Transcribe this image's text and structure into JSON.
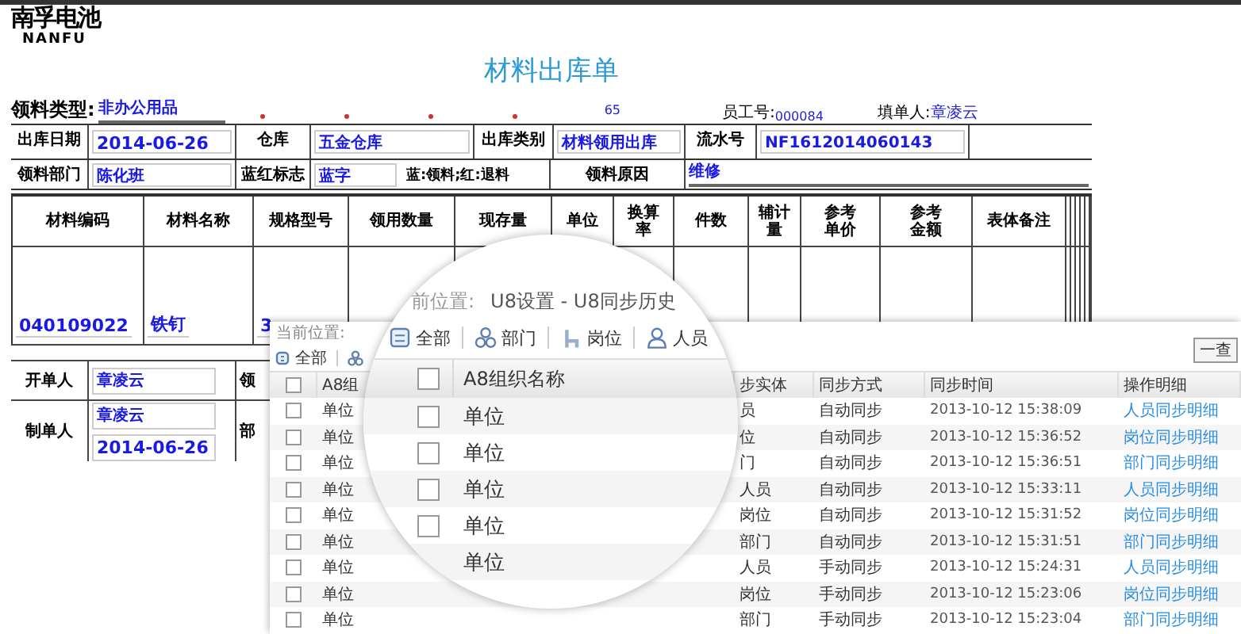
{
  "logo": {
    "name": "南孚电池",
    "brand": "NANFU"
  },
  "form": {
    "title": "材料出库单",
    "material_type": {
      "label": "领料类型:",
      "value": "非办公用品"
    },
    "code_fragment": "65",
    "employee_no": {
      "label": "员工号:",
      "value": "000084"
    },
    "filler": {
      "label": "填单人:",
      "value": "章凌云"
    },
    "row_1": [
      {
        "label": "出库日期",
        "value": "2014-06-26"
      },
      {
        "label": "仓库",
        "value": "五金仓库"
      },
      {
        "label": "出库类别",
        "value": "材料领用出库"
      },
      {
        "label": "流水号",
        "value": "NF1612014060143"
      }
    ],
    "row_2": [
      {
        "label": "领料部门",
        "value": "陈化班"
      },
      {
        "label": "蓝红标志",
        "value": "蓝字",
        "note": "蓝:领料;红:退料"
      },
      {
        "label": "领料原因",
        "value": "维修"
      }
    ],
    "items": {
      "columns": [
        "材料编码",
        "材料名称",
        "规格型号",
        "领用数量",
        "现存量",
        "单位",
        "换算率",
        "件数",
        "辅计量",
        "参考单价",
        "参考金额",
        "表体备注"
      ],
      "rows": [
        [
          "040109022",
          "铁钉",
          "3"
        ]
      ]
    },
    "issuer": {
      "label": "开单人",
      "value": "章凌云"
    },
    "receiver_label": "领",
    "maker": {
      "label": "制单人",
      "value": "章凌云",
      "date": "2014-06-26"
    },
    "dept_label": "部"
  },
  "sync_list": {
    "breadcrumb": "当前位置:",
    "toolbar": [
      "全部"
    ],
    "query_button": "一查",
    "header_checked": false,
    "columns": [
      "A8组",
      "步实体",
      "同步方式",
      "同步时间",
      "操作明细"
    ],
    "rows": [
      {
        "checked": false,
        "org": "单位",
        "entity": "员",
        "mode": "自动同步",
        "time": "2013-10-12 15:38:09",
        "link": "人员同步明细"
      },
      {
        "checked": false,
        "org": "单位",
        "entity": "位",
        "mode": "自动同步",
        "time": "2013-10-12 15:36:52",
        "link": "岗位同步明细"
      },
      {
        "checked": false,
        "org": "单位",
        "entity": "门",
        "mode": "自动同步",
        "time": "2013-10-12 15:36:51",
        "link": "部门同步明细"
      },
      {
        "checked": false,
        "org": "单位",
        "entity": "人员",
        "mode": "自动同步",
        "time": "2013-10-12 15:33:11",
        "link": "人员同步明细"
      },
      {
        "checked": false,
        "org": "单位",
        "entity": "岗位",
        "mode": "自动同步",
        "time": "2013-10-12 15:31:52",
        "link": "岗位同步明细"
      },
      {
        "checked": false,
        "org": "单位",
        "entity": "部门",
        "mode": "自动同步",
        "time": "2013-10-12 15:31:51",
        "link": "部门同步明细"
      },
      {
        "checked": false,
        "org": "单位",
        "entity": "人员",
        "mode": "手动同步",
        "time": "2013-10-12 15:24:31",
        "link": "人员同步明细"
      },
      {
        "checked": false,
        "org": "单位",
        "entity": "岗位",
        "mode": "手动同步",
        "time": "2013-10-12 15:23:06",
        "link": "岗位同步明细"
      },
      {
        "checked": false,
        "org": "单位",
        "entity": "部门",
        "mode": "手动同步",
        "time": "2013-10-12 15:23:04",
        "link": "部门同步明细"
      }
    ]
  },
  "magnifier": {
    "breadcrumb": "前位置:",
    "path": "U8设置 - U8同步历史",
    "toolbar": [
      {
        "kind": "all",
        "label": "全部"
      },
      {
        "kind": "dept",
        "label": "部门"
      },
      {
        "kind": "post",
        "label": "岗位"
      },
      {
        "kind": "person",
        "label": "人员"
      }
    ],
    "column": "A8组织名称",
    "header_checked": false,
    "rows": [
      {
        "checked": false,
        "label": "单位"
      },
      {
        "checked": false,
        "label": "单位"
      },
      {
        "checked": false,
        "label": "单位"
      },
      {
        "checked": false,
        "label": "单位"
      },
      {
        "label": "单位"
      }
    ]
  }
}
